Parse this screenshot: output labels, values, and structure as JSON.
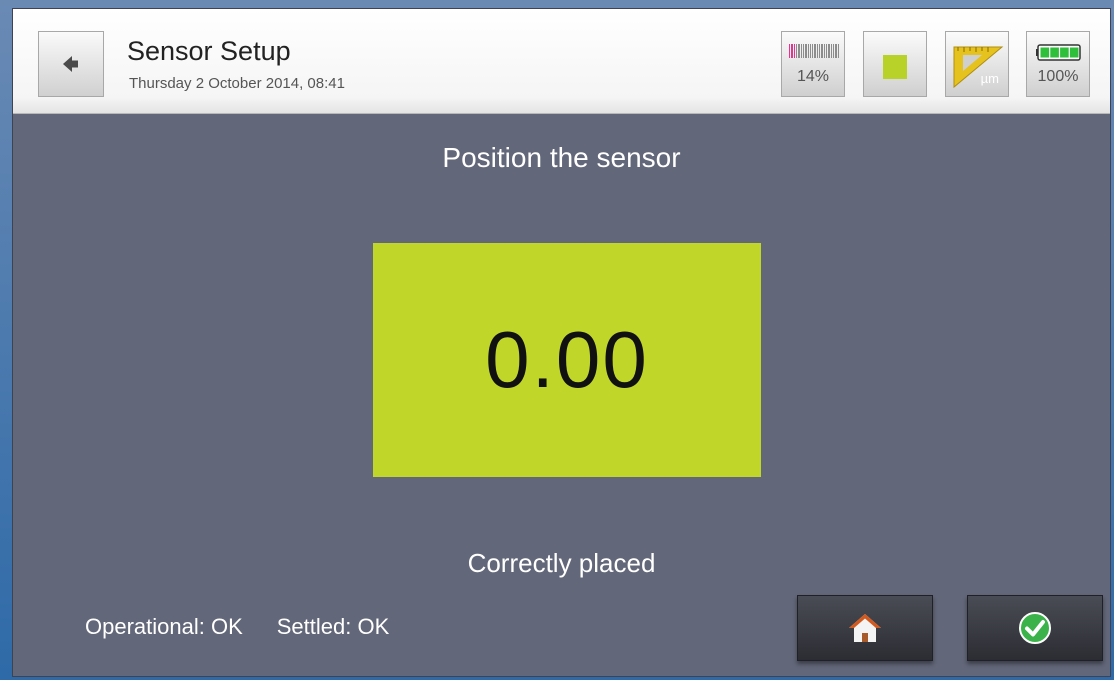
{
  "header": {
    "title": "Sensor Setup",
    "datetime": "Thursday 2 October 2014, 08:41",
    "back_icon": "arrow-left-icon",
    "signal": {
      "percent_label": "14%",
      "level": 0.14,
      "color": "#e3358f"
    },
    "stop": {
      "icon": "stop-square-icon",
      "color": "#b8d22a"
    },
    "unit": {
      "label": "µm",
      "icon": "ruler-triangle-icon"
    },
    "battery": {
      "percent_label": "100%",
      "level": 1.0,
      "color": "#2fbf3a"
    }
  },
  "main": {
    "instruction": "Position the sensor",
    "reading": "0.00",
    "reading_bg": "#c0d72a",
    "status": "Correctly placed"
  },
  "footer": {
    "operational": "Operational: OK",
    "settled": "Settled: OK",
    "home_icon": "home-icon",
    "confirm_icon": "checkmark-icon"
  }
}
